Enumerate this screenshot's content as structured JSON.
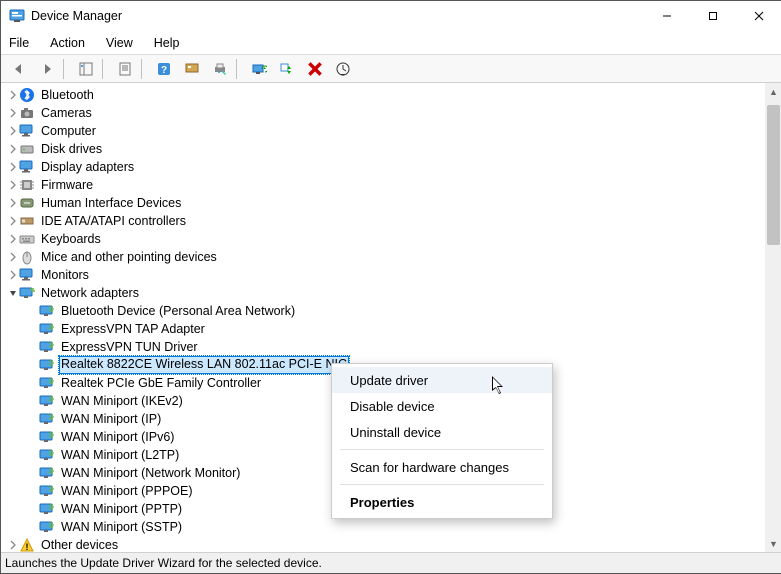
{
  "title": "Device Manager",
  "menus": [
    "File",
    "Action",
    "View",
    "Help"
  ],
  "status": "Launches the Update Driver Wizard for the selected device.",
  "toolbar_icons": [
    "back",
    "forward",
    "show-hide",
    "properties-sheet",
    "help",
    "refresh",
    "update-driver",
    "scan",
    "enable",
    "uninstall",
    "device-install"
  ],
  "tree": [
    {
      "label": "Bluetooth",
      "icon": "bluetooth",
      "chev": "r"
    },
    {
      "label": "Cameras",
      "icon": "camera",
      "chev": "r"
    },
    {
      "label": "Computer",
      "icon": "monitor",
      "chev": "r"
    },
    {
      "label": "Disk drives",
      "icon": "disk",
      "chev": "r"
    },
    {
      "label": "Display adapters",
      "icon": "monitor",
      "chev": "r"
    },
    {
      "label": "Firmware",
      "icon": "chip",
      "chev": "r"
    },
    {
      "label": "Human Interface Devices",
      "icon": "hid",
      "chev": "r"
    },
    {
      "label": "IDE ATA/ATAPI controllers",
      "icon": "ide",
      "chev": "r"
    },
    {
      "label": "Keyboards",
      "icon": "keyboard",
      "chev": "r"
    },
    {
      "label": "Mice and other pointing devices",
      "icon": "mouse",
      "chev": "r"
    },
    {
      "label": "Monitors",
      "icon": "monitor",
      "chev": "r"
    },
    {
      "label": "Network adapters",
      "icon": "network",
      "chev": "d",
      "children": [
        {
          "label": "Bluetooth Device (Personal Area Network)",
          "icon": "net"
        },
        {
          "label": "ExpressVPN TAP Adapter",
          "icon": "net"
        },
        {
          "label": "ExpressVPN TUN Driver",
          "icon": "net"
        },
        {
          "label": "Realtek 8822CE Wireless LAN 802.11ac PCI-E NIC",
          "icon": "net",
          "selected": true
        },
        {
          "label": "Realtek PCIe GbE Family Controller",
          "icon": "net"
        },
        {
          "label": "WAN Miniport (IKEv2)",
          "icon": "net"
        },
        {
          "label": "WAN Miniport (IP)",
          "icon": "net"
        },
        {
          "label": "WAN Miniport (IPv6)",
          "icon": "net"
        },
        {
          "label": "WAN Miniport (L2TP)",
          "icon": "net"
        },
        {
          "label": "WAN Miniport (Network Monitor)",
          "icon": "net"
        },
        {
          "label": "WAN Miniport (PPPOE)",
          "icon": "net"
        },
        {
          "label": "WAN Miniport (PPTP)",
          "icon": "net"
        },
        {
          "label": "WAN Miniport (SSTP)",
          "icon": "net"
        }
      ]
    },
    {
      "label": "Other devices",
      "icon": "warn",
      "chev": "r"
    }
  ],
  "context_menu": [
    {
      "label": "Update driver",
      "hl": true
    },
    {
      "label": "Disable device"
    },
    {
      "label": "Uninstall device"
    },
    {
      "sep": true
    },
    {
      "label": "Scan for hardware changes"
    },
    {
      "sep": true
    },
    {
      "label": "Properties",
      "bold": true
    }
  ]
}
